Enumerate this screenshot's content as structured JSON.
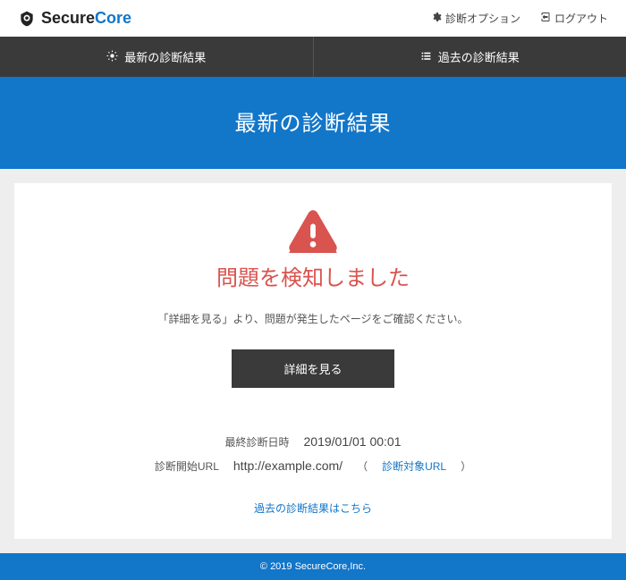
{
  "brand": {
    "part1": "Secure",
    "part2": "Core"
  },
  "topbar": {
    "options_label": "診断オプション",
    "logout_label": "ログアウト"
  },
  "nav": {
    "latest_label": "最新の診断結果",
    "past_label": "過去の診断結果"
  },
  "hero": {
    "title": "最新の診断結果"
  },
  "status": {
    "title": "問題を検知しました",
    "text": "「詳細を見る」より、問題が発生したページをご確認ください。",
    "detail_button": "詳細を見る"
  },
  "meta": {
    "last_time_label": "最終診断日時",
    "last_time_value": "2019/01/01 00:01",
    "start_url_label": "診断開始URL",
    "start_url_value": "http://example.com/",
    "target_url_link": "診断対象URL"
  },
  "past_link": "過去の診断結果はこちら",
  "footer": "© 2019 SecureCore,Inc."
}
